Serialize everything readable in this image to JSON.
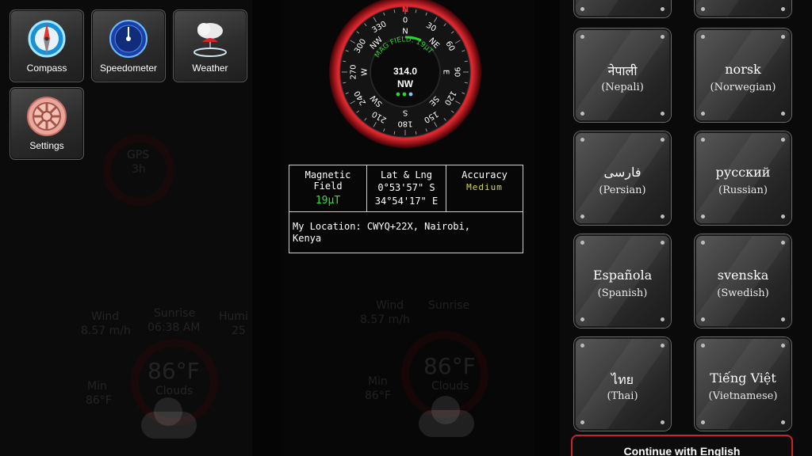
{
  "apps": [
    {
      "label": "Compass",
      "icon": "compass-icon"
    },
    {
      "label": "Speedometer",
      "icon": "speedometer-icon"
    },
    {
      "label": "Weather",
      "icon": "weather-icon"
    },
    {
      "label": "Settings",
      "icon": "settings-gear-icon"
    }
  ],
  "compass": {
    "ticks": [
      "0",
      "30",
      "60",
      "90",
      "120",
      "150",
      "180",
      "210",
      "240",
      "270",
      "300",
      "330"
    ],
    "directions": [
      "N",
      "NE",
      "E",
      "SE",
      "S",
      "SW",
      "W",
      "NW"
    ],
    "arc_label": "MAG FIELD: 19µT",
    "heading_value": "314.0",
    "heading_dir": "NW",
    "north_marker": "N"
  },
  "info": {
    "mag_label": "Magnetic Field",
    "mag_value": "19µT",
    "latlng_label": "Lat & Lng",
    "lat_value": "0°53'57\" S",
    "lng_value": "34°54'17\" E",
    "accuracy_label": "Accuracy",
    "accuracy_value": "Medium",
    "location_text": "My Location: CWYQ+22X, Nairobi, Kenya"
  },
  "ghost": {
    "wind_label": "Wind",
    "wind_value": "8.57 m/h",
    "sunrise_label": "Sunrise",
    "sunrise_value": "06:38 AM",
    "humidity_label": "Humi",
    "humidity_value": "25",
    "temp": "86°F",
    "condition": "Clouds",
    "min_label": "Min",
    "min_value": "86°F",
    "gps_label": "GPS",
    "gps_value": "3h"
  },
  "languages": [
    {
      "native": "नेपाली",
      "english": "(Nepali)"
    },
    {
      "native": "norsk",
      "english": "(Norwegian)"
    },
    {
      "native": "فارسی",
      "english": "(Persian)"
    },
    {
      "native": "русский",
      "english": "(Russian)"
    },
    {
      "native": "Española",
      "english": "(Spanish)"
    },
    {
      "native": "svenska",
      "english": "(Swedish)"
    },
    {
      "native": "ไทย",
      "english": "(Thai)"
    },
    {
      "native": "Tiếng Việt",
      "english": "(Vietnamese)"
    }
  ],
  "continue_label": "Continue with English",
  "colors": {
    "accent_red": "#c8242a",
    "value_green": "#36e03a",
    "value_yellow": "#d9d94a"
  }
}
